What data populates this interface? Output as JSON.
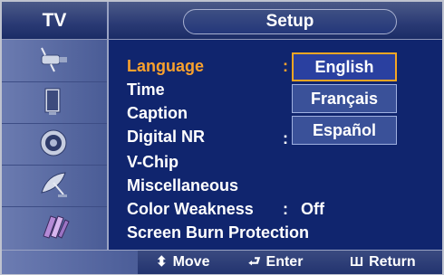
{
  "header": {
    "section": "TV",
    "title": "Setup"
  },
  "icons": [
    {
      "name": "antenna-plug-icon"
    },
    {
      "name": "monitor-icon"
    },
    {
      "name": "speaker-icon"
    },
    {
      "name": "satellite-dish-icon"
    },
    {
      "name": "input-plugs-icon"
    }
  ],
  "menu": {
    "items": [
      {
        "label": "Language",
        "separator": ":",
        "value": ""
      },
      {
        "label": "Time",
        "separator": "",
        "value": ""
      },
      {
        "label": "Caption",
        "separator": "",
        "value": ""
      },
      {
        "label": "Digital NR",
        "separator": ":",
        "value": ""
      },
      {
        "label": "V-Chip",
        "separator": "",
        "value": ""
      },
      {
        "label": "Miscellaneous",
        "separator": "",
        "value": ""
      },
      {
        "label": "Color Weakness",
        "separator": ":",
        "value": "Off"
      },
      {
        "label": "Screen Burn Protection",
        "separator": "",
        "value": ""
      }
    ],
    "active_index": 0
  },
  "language_dropdown": {
    "options": [
      "English",
      "Français",
      "Español"
    ],
    "selected": "English"
  },
  "footer": {
    "move": {
      "glyph": "⬍",
      "label": "Move"
    },
    "enter": {
      "glyph": "⮐",
      "label": "Enter"
    },
    "return": {
      "glyph": "Ш",
      "label": "Return"
    }
  },
  "colors": {
    "background": "#10256e",
    "active_item": "#f9a12d",
    "selection_border": "#f5a623",
    "dropdown_fill": "#3a5199"
  }
}
